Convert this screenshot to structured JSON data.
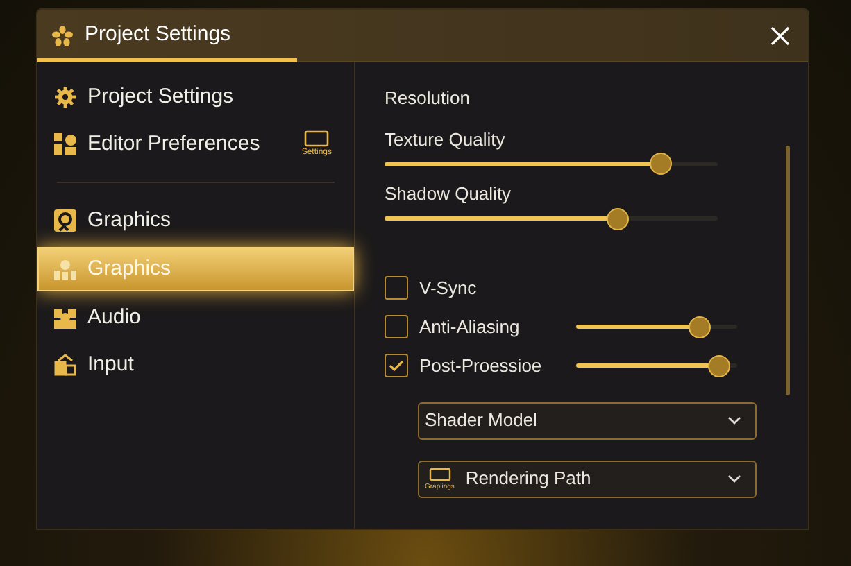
{
  "window": {
    "title": "Project Settings"
  },
  "sidebar": {
    "items": [
      {
        "label": "Project Settings",
        "selected": false
      },
      {
        "label": "Editor Preferences",
        "selected": false,
        "badge": "Settings"
      },
      {
        "label": "Graphics",
        "selected": false
      },
      {
        "label": "Graphics",
        "selected": true
      },
      {
        "label": "Audio",
        "selected": false
      },
      {
        "label": "Input",
        "selected": false
      }
    ]
  },
  "content": {
    "section": "Resolution",
    "sliders": [
      {
        "label": "Texture Quality",
        "level": 0.83
      },
      {
        "label": "Shadow Quality",
        "level": 0.7
      }
    ],
    "options": [
      {
        "label": "V-Sync",
        "checked": false
      },
      {
        "label": "Anti-Aliasing",
        "checked": false,
        "level": 0.77
      },
      {
        "label": "Post-Proessioe",
        "checked": true,
        "level": 0.89
      }
    ],
    "dropdowns": [
      {
        "label": "Shader Model"
      },
      {
        "label": "Rendering Path",
        "icon_caption": "Graplings"
      }
    ]
  }
}
